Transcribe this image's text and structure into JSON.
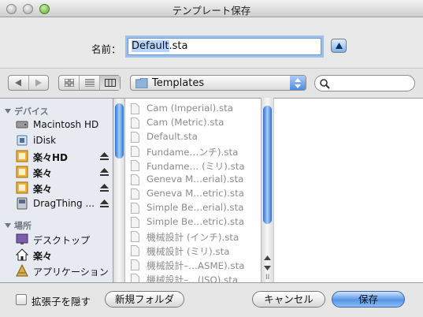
{
  "window": {
    "title": "テンプレート保存"
  },
  "save_as": {
    "label": "名前：",
    "value_selected": "Default",
    "value_rest": ".sta"
  },
  "location": {
    "folder_name": "Templates",
    "search_placeholder": ""
  },
  "sidebar": {
    "devices_header": "デバイス",
    "devices": [
      {
        "label": "Macintosh HD",
        "icon": "hard-drive-icon",
        "eject": false,
        "bold": false
      },
      {
        "label": "iDisk",
        "icon": "idisk-icon",
        "eject": false,
        "bold": false
      },
      {
        "label": "楽々HD",
        "icon": "drive-icon",
        "eject": true,
        "bold": true
      },
      {
        "label": "楽々",
        "icon": "drive-icon",
        "eject": true,
        "bold": true
      },
      {
        "label": "楽々",
        "icon": "drive-icon",
        "eject": true,
        "bold": true
      },
      {
        "label": "DragThing ...",
        "icon": "disk-image-icon",
        "eject": true,
        "bold": false
      }
    ],
    "places_header": "場所",
    "places": [
      {
        "label": "デスクトップ",
        "icon": "desktop-icon",
        "bold": false
      },
      {
        "label": "楽々",
        "icon": "home-icon",
        "bold": true
      },
      {
        "label": "アプリケーション",
        "icon": "applications-icon",
        "bold": false
      }
    ]
  },
  "files": [
    "Cam (Imperial).sta",
    "Cam (Metric).sta",
    "Default.sta",
    "Fundame…ンチ).sta",
    "Fundame… (ミリ).sta",
    "Geneva M…erial).sta",
    "Geneva M…etric).sta",
    "Simple Be…erial).sta",
    "Simple Be…etric).sta",
    "機械設計 (インチ).sta",
    "機械設計 (ミリ).sta",
    "機械設計–…ASME).sta",
    "機械設計–…(ISO).sta"
  ],
  "bottom": {
    "hide_extension_label": "拡張子を隠す",
    "hide_extension_checked": false,
    "new_folder": "新規フォルダ",
    "cancel": "キャンセル",
    "save": "保存"
  },
  "colors": {
    "accent": "#5795e6",
    "focus_ring": "#9cc0ee",
    "sidebar_bg": "#e7ebf1"
  }
}
